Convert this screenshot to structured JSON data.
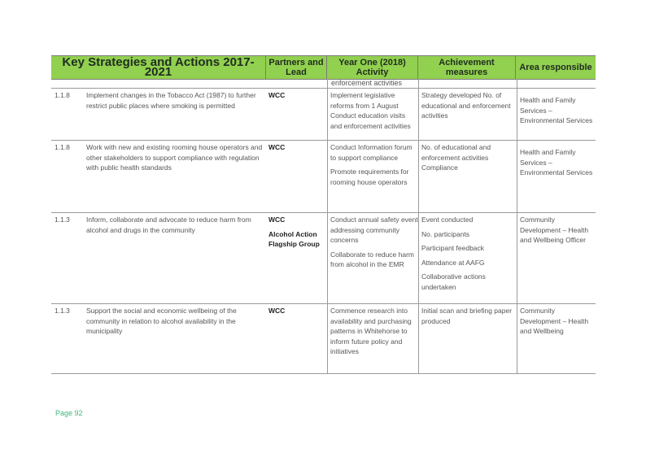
{
  "header": {
    "key_strategies": "Key Strategies and Actions 2017-2021",
    "partners": "Partners and Lead",
    "activity": "Year One (2018) Activity",
    "measures": "Achievement measures",
    "area": "Area responsible"
  },
  "continuation": "enforcement activities",
  "rows": [
    {
      "num": "1.1.8",
      "description": "Implement changes in the Tobacco Act (1987) to further restrict public places where smoking is permitted",
      "partners": [
        "WCC"
      ],
      "activity": [
        "Implement legislative reforms from 1 August Conduct education visits and enforcement activities"
      ],
      "measures": [
        "Strategy developed No. of educational and enforcement activities"
      ],
      "area": "Health and Family Services – Environmental Services"
    },
    {
      "num": "1.1.8",
      "description": "Work with new and existing rooming house operators and other stakeholders to support compliance with regulation with public health standards",
      "partners": [
        "WCC"
      ],
      "activity": [
        "Conduct Information forum to support compliance",
        "Promote requirements for rooming house operators"
      ],
      "measures": [
        "No. of educational and enforcement activities Compliance"
      ],
      "area": "Health and Family Services – Environmental Services"
    },
    {
      "num": "1.1.3",
      "description": "Inform, collaborate and advocate to reduce harm from alcohol and drugs in the community",
      "partners": [
        "WCC",
        "Alcohol Action Flagship Group"
      ],
      "activity": [
        "Conduct annual safety event addressing community concerns",
        "Collaborate to reduce harm from alcohol in the EMR"
      ],
      "measures": [
        "Event conducted",
        "No. participants",
        "Participant feedback",
        "Attendance at AAFG",
        "Collaborative actions undertaken"
      ],
      "area": "Community Development – Health and Wellbeing Officer"
    },
    {
      "num": "1.1.3",
      "description": "Support the social and economic wellbeing of the community in relation to alcohol availability in the municipality",
      "partners": [
        "WCC"
      ],
      "activity": [
        "Commence research into availability and purchasing patterns in Whitehorse to inform future policy and initiatives"
      ],
      "measures": [
        "Initial scan and briefing paper produced"
      ],
      "area": "Community Development – Health and Wellbeing"
    }
  ],
  "footer": {
    "page_label": "Page 92"
  }
}
